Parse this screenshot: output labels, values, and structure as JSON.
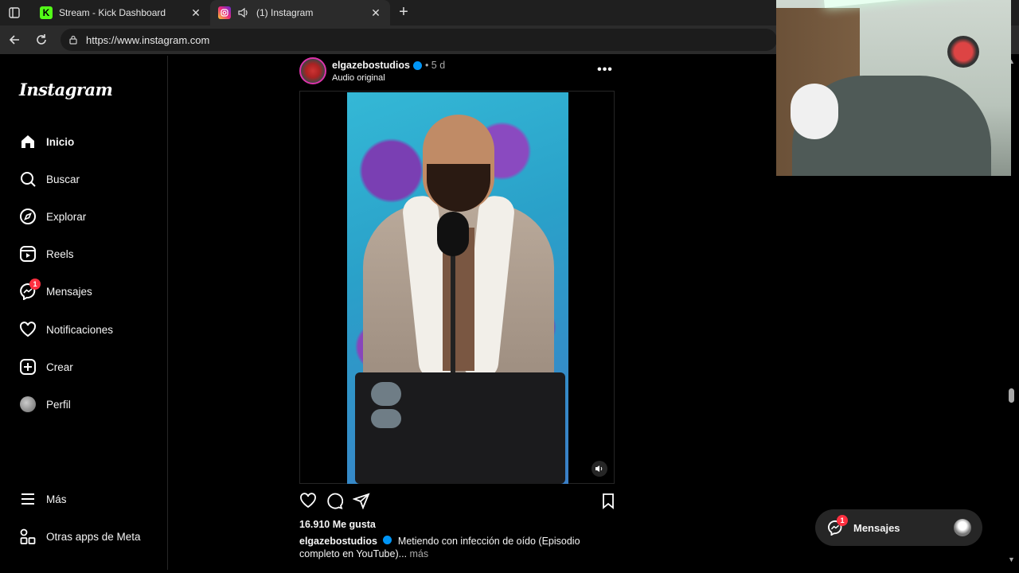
{
  "browser": {
    "tabs": [
      {
        "title": "Stream - Kick Dashboard",
        "favicon": "kick-icon",
        "active": false
      },
      {
        "title": "(1) Instagram",
        "favicon": "instagram-icon",
        "active": true
      }
    ],
    "url": "https://www.instagram.com"
  },
  "sidebar": {
    "logo": "Instagram",
    "items": [
      {
        "label": "Inicio",
        "icon": "home-icon",
        "active": true
      },
      {
        "label": "Buscar",
        "icon": "search-icon"
      },
      {
        "label": "Explorar",
        "icon": "compass-icon"
      },
      {
        "label": "Reels",
        "icon": "reels-icon"
      },
      {
        "label": "Mensajes",
        "icon": "messenger-icon",
        "badge": "1"
      },
      {
        "label": "Notificaciones",
        "icon": "heart-icon"
      },
      {
        "label": "Crear",
        "icon": "plus-square-icon"
      },
      {
        "label": "Perfil",
        "icon": "avatar-icon"
      }
    ],
    "bottom": [
      {
        "label": "Más",
        "icon": "menu-icon"
      },
      {
        "label": "Otras apps de Meta",
        "icon": "apps-icon"
      }
    ]
  },
  "post": {
    "username": "elgazebostudios",
    "time": "• 5 d",
    "audio": "Audio original",
    "likes": "16.910 Me gusta",
    "caption_user": "elgazebostudios",
    "caption_text": "Metiendo con infección de oído (Episodio completo en YouTube)...",
    "caption_more": "más"
  },
  "messages_pill": {
    "label": "Mensajes",
    "badge": "1"
  },
  "colors": {
    "accent": "#0095f6",
    "notification": "#ff3040",
    "background": "#000000"
  }
}
